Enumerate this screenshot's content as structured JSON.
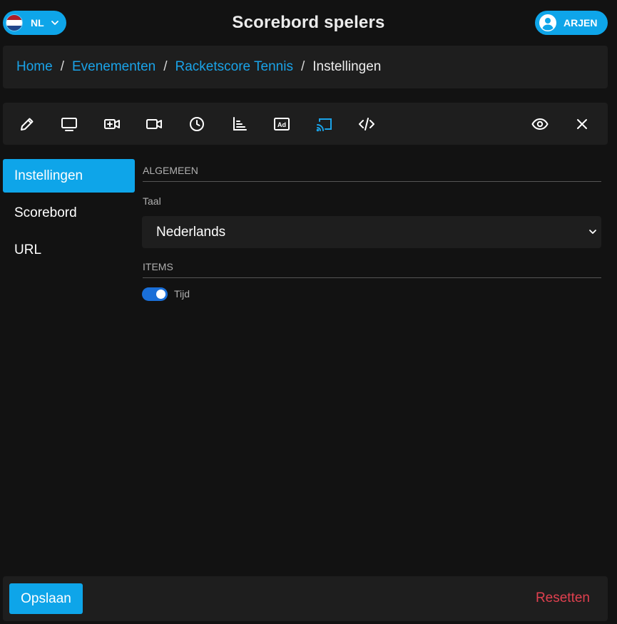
{
  "header": {
    "title": "Scorebord spelers",
    "language": {
      "code": "NL",
      "flag_colors": [
        "#ae1c28",
        "#ffffff",
        "#21468b"
      ]
    },
    "user": {
      "name": "ARJEN"
    }
  },
  "breadcrumb": {
    "items": [
      "Home",
      "Evenementen",
      "Racketscore Tennis"
    ],
    "separator": "/",
    "current": "Instellingen"
  },
  "toolbar": {
    "icons": [
      "pencil-icon",
      "monitor-icon",
      "video-add-icon",
      "video-icon",
      "clock-icon",
      "bar-chart-icon",
      "ad-icon",
      "cast-icon",
      "code-icon",
      "eye-icon",
      "close-icon"
    ],
    "active_icon": "cast-icon"
  },
  "sidebar": {
    "items": [
      {
        "label": "Instellingen",
        "active": true
      },
      {
        "label": "Scorebord",
        "active": false
      },
      {
        "label": "URL",
        "active": false
      }
    ]
  },
  "main": {
    "general_section": "ALGEMEEN",
    "language_field": {
      "label": "Taal",
      "value": "Nederlands"
    },
    "items_section": "ITEMS",
    "toggles": [
      {
        "label": "Tijd",
        "on": true
      }
    ]
  },
  "footer": {
    "save_label": "Opslaan",
    "reset_label": "Resetten"
  },
  "colors": {
    "accent": "#0ea5e9",
    "link": "#1aa3e8",
    "danger": "#e0404f",
    "background": "#121212",
    "panel": "#1e1e1e"
  }
}
